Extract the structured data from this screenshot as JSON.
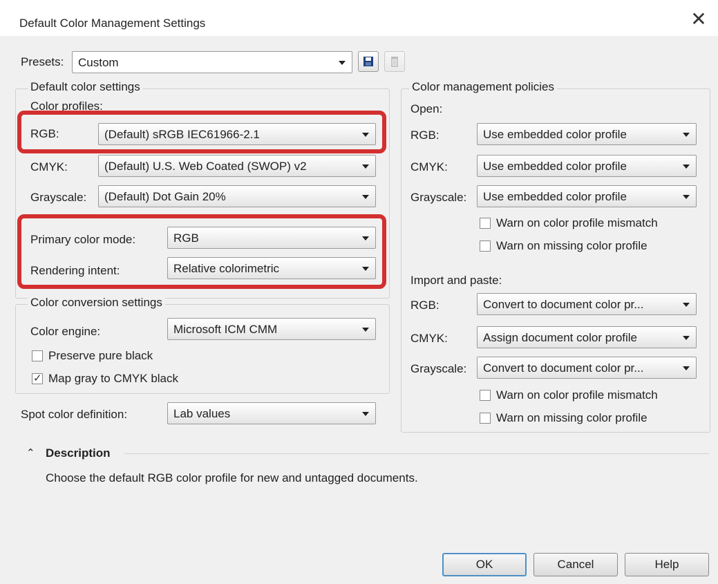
{
  "window": {
    "title": "Default Color Management Settings",
    "close_glyph": "✕"
  },
  "presets": {
    "label": "Presets:",
    "value": "Custom"
  },
  "default_color_settings": {
    "legend": "Default color settings",
    "profiles_label": "Color profiles:",
    "rgb": {
      "label": "RGB:",
      "value": "(Default) sRGB IEC61966-2.1"
    },
    "cmyk": {
      "label": "CMYK:",
      "value": "(Default) U.S. Web Coated (SWOP) v2"
    },
    "grayscale": {
      "label": "Grayscale:",
      "value": "(Default) Dot Gain 20%"
    },
    "primary_mode": {
      "label": "Primary color mode:",
      "value": "RGB"
    },
    "rendering_intent": {
      "label": "Rendering intent:",
      "value": "Relative colorimetric"
    }
  },
  "conversion": {
    "legend": "Color conversion settings",
    "engine": {
      "label": "Color engine:",
      "value": "Microsoft ICM CMM"
    },
    "preserve_black": {
      "label": "Preserve pure black",
      "checked": false
    },
    "map_gray": {
      "label": "Map gray to CMYK black",
      "checked": true
    }
  },
  "spot": {
    "label": "Spot color definition:",
    "value": "Lab values"
  },
  "policies": {
    "legend": "Color management policies",
    "open": {
      "heading": "Open:",
      "rgb": {
        "label": "RGB:",
        "value": "Use embedded color profile"
      },
      "cmyk": {
        "label": "CMYK:",
        "value": "Use embedded color profile"
      },
      "grayscale": {
        "label": "Grayscale:",
        "value": "Use embedded color profile"
      },
      "warn_mismatch": {
        "label": "Warn on color profile mismatch",
        "checked": false
      },
      "warn_missing": {
        "label": "Warn on missing color profile",
        "checked": false
      }
    },
    "import": {
      "heading": "Import and paste:",
      "rgb": {
        "label": "RGB:",
        "value": "Convert to document color pr..."
      },
      "cmyk": {
        "label": "CMYK:",
        "value": "Assign document color profile"
      },
      "grayscale": {
        "label": "Grayscale:",
        "value": "Convert to document color pr..."
      },
      "warn_mismatch": {
        "label": "Warn on color profile mismatch",
        "checked": false
      },
      "warn_missing": {
        "label": "Warn on missing color profile",
        "checked": false
      }
    }
  },
  "description": {
    "heading": "Description",
    "toggle_glyph": "⌃",
    "text": "Choose the default RGB color profile for new and untagged documents."
  },
  "buttons": {
    "ok": "OK",
    "cancel": "Cancel",
    "help": "Help"
  },
  "colors": {
    "highlight": "#d32f2f",
    "default_button_border": "#4e8fc9"
  },
  "icons": {
    "save": "save-icon",
    "delete": "trash-icon"
  }
}
